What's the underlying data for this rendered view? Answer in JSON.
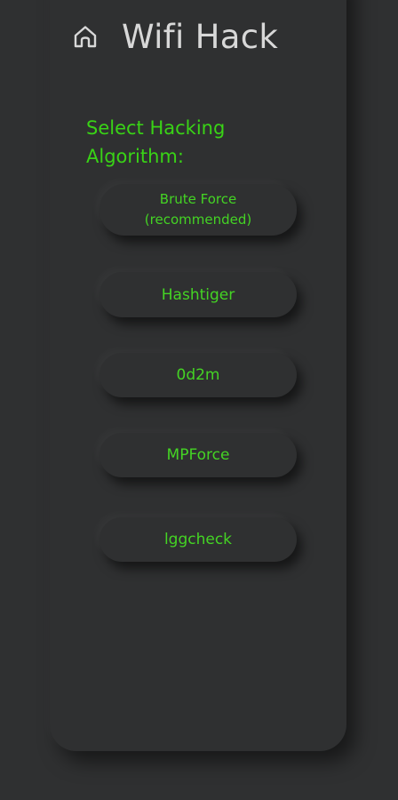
{
  "header": {
    "icon": "home-icon",
    "title": "Wifi Hack"
  },
  "prompt": "Select Hacking Algorithm:",
  "algorithms": [
    {
      "label": "Brute Force",
      "note": "(recommended)"
    },
    {
      "label": "Hashtiger"
    },
    {
      "label": "0d2m"
    },
    {
      "label": "MPForce"
    },
    {
      "label": "lggcheck"
    }
  ],
  "colors": {
    "background": "#2f3031",
    "accent": "#39d316",
    "title": "#d8d8d8"
  }
}
